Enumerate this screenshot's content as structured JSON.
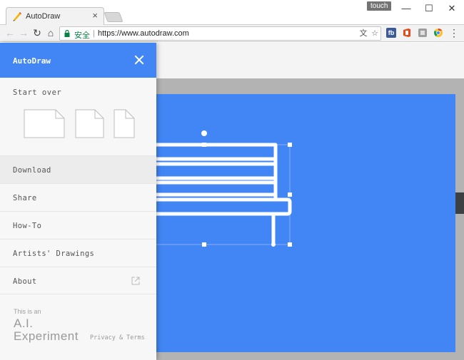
{
  "browser": {
    "tab_title": "AutoDraw",
    "tab_close": "×",
    "touch_badge": "touch",
    "minimize": "—",
    "maximize": "☐",
    "close": "✕",
    "back": "←",
    "forward": "→",
    "reload": "↻",
    "home": "⌂",
    "security_label": "安全",
    "url": "https://www.autodraw.com",
    "translate_icon": "文",
    "star": "☆",
    "menu": "⋮",
    "extensions": [
      {
        "name": "facebook-extension-icon",
        "label": "fb",
        "color": "#3b5998"
      },
      {
        "name": "office-extension-icon",
        "label": "",
        "color": "#e64a19"
      },
      {
        "name": "gray-extension-icon",
        "label": "",
        "color": "#9e9e9e"
      },
      {
        "name": "chrome-extension-icon",
        "label": "",
        "color": "#fbc02d"
      }
    ]
  },
  "drawer": {
    "title": "AutoDraw",
    "start_over": "Start over",
    "menu": [
      {
        "label": "Download",
        "selected": true
      },
      {
        "label": "Share",
        "selected": false
      },
      {
        "label": "How-To",
        "selected": false
      },
      {
        "label": "Artists' Drawings",
        "selected": false
      },
      {
        "label": "About",
        "selected": false,
        "external": true
      }
    ],
    "footer": {
      "small": "This is an",
      "big_line1": "A.I.",
      "big_line2": "Experiment",
      "links": "Privacy & Terms"
    }
  },
  "colors": {
    "accent": "#4285f4",
    "drawer_bg": "#f7f7f7",
    "canvas_frame": "#b3b3b3"
  }
}
